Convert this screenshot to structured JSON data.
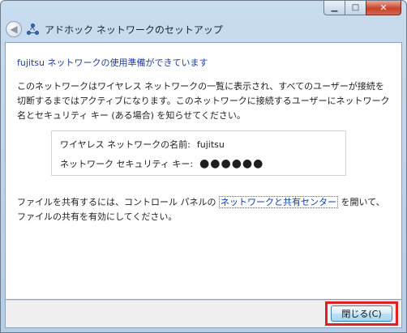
{
  "window": {
    "title": "アドホック ネットワークのセットアップ",
    "back_glyph": "◀",
    "min_glyph": "▁",
    "max_glyph": "□",
    "close_glyph": "✕"
  },
  "content": {
    "heading": "fujitsu ネットワークの使用準備ができています",
    "paragraph1": "このネットワークはワイヤレス ネットワークの一覧に表示され、すべてのユーザーが接続を切断するまではアクティブになります。このネットワークに接続するユーザーにネットワーク名とセキュリティ キー (ある場合) を知らせてください。",
    "network_name_label": "ワイヤレス ネットワークの名前:",
    "network_name_value": "fujitsu",
    "security_key_label": "ネットワーク セキュリティ キー:",
    "security_key_value": "●●●●●●",
    "paragraph2_before": "ファイルを共有するには、コントロール パネルの",
    "paragraph2_link": "ネットワークと共有センター",
    "paragraph2_after": "を開いて、ファイルの共有を有効にしてください。"
  },
  "footer": {
    "close_label": "閉じる(C)"
  }
}
